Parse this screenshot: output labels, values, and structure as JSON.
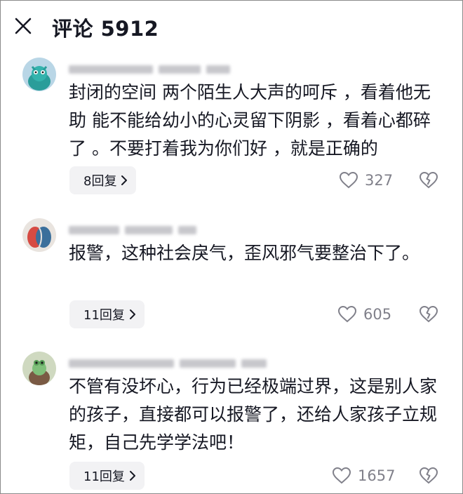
{
  "header": {
    "title": "评论 5912",
    "close_icon": "close-icon"
  },
  "comments": [
    {
      "text": "封闭的空间 两个陌生人大声的呵斥 ，看着他无助 能不能给幼小的心灵留下阴影 ，看着心都碎了 。不要打着我为你们好 ，就是正确的",
      "replies_label": "8回复",
      "likes": "327",
      "avatar_icon": "blue-creature-avatar"
    },
    {
      "text": "报警，这种社会戾气，歪风邪气要整治下了。",
      "replies_label": "11回复",
      "likes": "605",
      "avatar_icon": "two-faces-avatar"
    },
    {
      "text": "不管有没坏心，行为已经极端过界，这是别人家的孩子，直接都可以报警了，还给人家孩子立规矩，自己先学学法吧！",
      "replies_label": "11回复",
      "likes": "1657",
      "avatar_icon": "green-creature-avatar"
    }
  ],
  "colors": {
    "text": "#161823",
    "muted": "#80808a",
    "chip_bg": "#f2f2f4"
  }
}
